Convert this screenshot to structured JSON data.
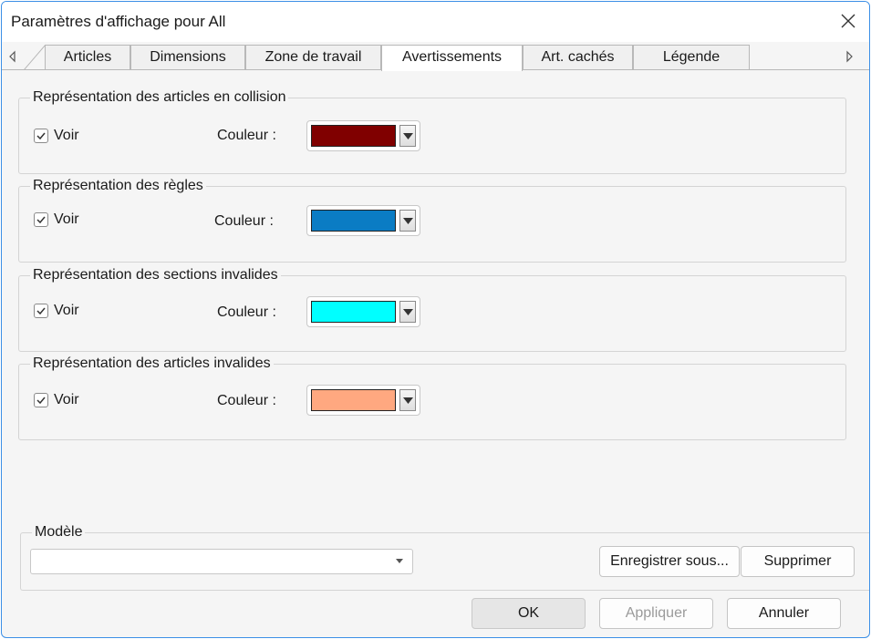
{
  "window": {
    "title": "Paramètres d'affichage pour All"
  },
  "tabs": [
    {
      "label": "Articles"
    },
    {
      "label": "Dimensions"
    },
    {
      "label": "Zone de travail"
    },
    {
      "label": "Avertissements",
      "active": true
    },
    {
      "label": "Art. cachés"
    },
    {
      "label": "Légende"
    }
  ],
  "groups": [
    {
      "title": "Représentation des articles en collision",
      "show_label": "Voir",
      "checked": true,
      "color_label": "Couleur :",
      "color": "#800000"
    },
    {
      "title": "Représentation des règles",
      "show_label": "Voir",
      "checked": true,
      "color_label": "Couleur :",
      "color": "#0a7cc4"
    },
    {
      "title": "Représentation des sections invalides",
      "show_label": "Voir",
      "checked": true,
      "color_label": "Couleur :",
      "color": "#00ffff"
    },
    {
      "title": "Représentation des articles invalides",
      "show_label": "Voir",
      "checked": true,
      "color_label": "Couleur :",
      "color": "#ffa880"
    }
  ],
  "modele": {
    "title": "Modèle",
    "value": "",
    "save_as_label": "Enregistrer sous...",
    "delete_label": "Supprimer"
  },
  "footer": {
    "ok_label": "OK",
    "apply_label": "Appliquer",
    "cancel_label": "Annuler"
  },
  "icons": {
    "close": "close-icon",
    "tab_scroll_left": "triangle-left-icon",
    "tab_scroll_right": "triangle-right-icon",
    "dropdown": "chevron-down-icon",
    "check": "checkmark-icon"
  }
}
